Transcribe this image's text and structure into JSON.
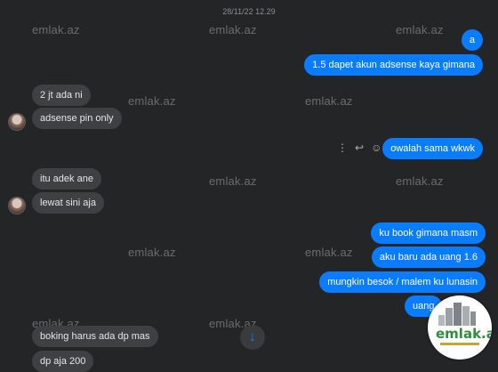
{
  "timestamp": "28/11/22 12.29",
  "watermark": "emlak.az",
  "messages": {
    "m1": "a",
    "m2": "1.5 dapet akun adsense kaya gimana",
    "m3": "2 jt ada ni",
    "m4": "adsense pin only",
    "m5": "owalah sama wkwk",
    "m6": "itu adek ane",
    "m7": "lewat sini aja",
    "m8": "ku book gimana masm",
    "m9": "aku baru ada uang 1.6",
    "m10": "mungkin besok / malem ku lunasin",
    "m11": "uang",
    "m12": "boking harus ada dp mas",
    "m13": "dp aja 200"
  },
  "icons": {
    "more": "⋮",
    "reply": "↩",
    "emoji": "☺",
    "scroll_down": "↓"
  },
  "logo": {
    "text": "emlak.az"
  },
  "colors": {
    "background": "#242526",
    "outgoing": "#0a7cff",
    "incoming": "#3e4042"
  }
}
